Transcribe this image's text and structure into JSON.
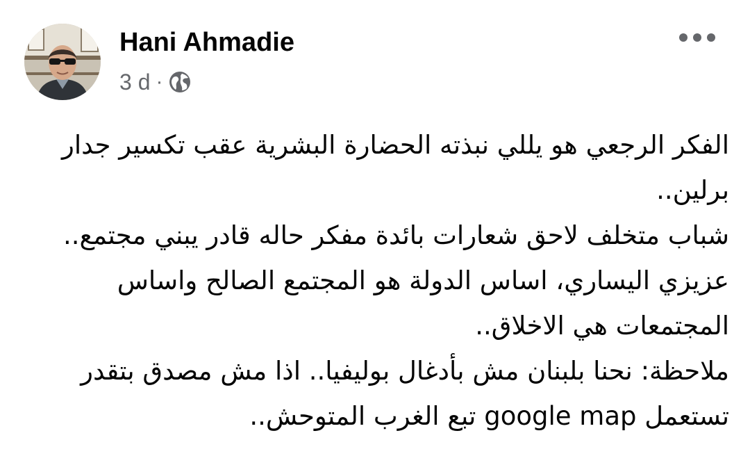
{
  "post": {
    "author_name": "Hani Ahmadie",
    "time": "3 d",
    "separator": "·",
    "privacy_icon": "globe-icon",
    "more_icon": "more-options-icon",
    "avatar_icon": "profile-photo",
    "paragraphs": [
      "الفكر الرجعي هو يللي نبذته الحضارة البشرية عقب تكسير جدار برلين..",
      "شباب متخلف لاحق شعارات بائدة مفكر حاله قادر يبني مجتمع..",
      "عزيزي اليساري، اساس الدولة هو المجتمع الصالح واساس المجتمعات هي الاخلاق..",
      "ملاحظة: نحنا بلبنان مش بأدغال بوليفيا.. اذا مش مصدق بتقدر تستعمل google map تبع الغرب المتوحش.."
    ]
  },
  "colors": {
    "text_primary": "#050505",
    "text_secondary": "#65676b",
    "background": "#ffffff"
  }
}
